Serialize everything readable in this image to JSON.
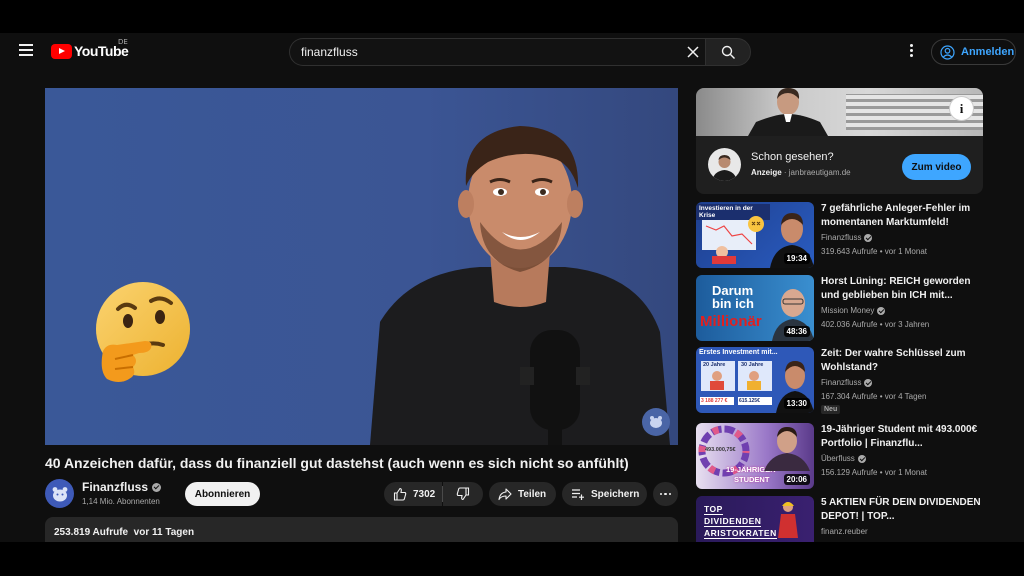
{
  "header": {
    "logo_text": "YouTube",
    "region": "DE",
    "search_value": "finanzfluss",
    "signin_label": "Anmelden"
  },
  "video": {
    "title": "40 Anzeichen dafür, dass du finanziell gut dastehst (auch wenn es sich nicht so anfühlt)",
    "channel": "Finanzfluss",
    "subscribers": "1,14 Mio. Abonnenten",
    "subscribe_label": "Abonnieren",
    "likes": "7302",
    "share_label": "Teilen",
    "save_label": "Speichern",
    "views": "253.819 Aufrufe",
    "age": "vor 11 Tagen"
  },
  "ad": {
    "title": "Schon gesehen?",
    "label": "Anzeige",
    "domain": "janbraeutigam.de",
    "cta": "Zum video"
  },
  "recommendations": [
    {
      "title": "7 gefährliche Anleger-Fehler im momentanen Marktumfeld!",
      "channel": "Finanzfluss",
      "views": "319.643 Aufrufe",
      "age": "vor 1 Monat",
      "duration": "19:34",
      "thumb_text": "Investieren in der Krise"
    },
    {
      "title": "Horst Lüning: REICH geworden und geblieben bin ICH mit...",
      "channel": "Mission Money",
      "views": "402.036 Aufrufe",
      "age": "vor 3 Jahren",
      "duration": "48:36",
      "thumb_line1": "Darum",
      "thumb_line2": "bin ich",
      "thumb_line3": "Millionär"
    },
    {
      "title": "Zeit: Der wahre Schlüssel zum Wohlstand?",
      "channel": "Finanzfluss",
      "views": "167.304 Aufrufe",
      "age": "vor 4 Tagen",
      "duration": "13:30",
      "badge": "Neu",
      "thumb_text": "Erstes Investment mit...",
      "thumb_col1": "20 Jahre",
      "thumb_col2": "30 Jahre",
      "thumb_val1": "3 188 277 €",
      "thumb_val2": "615.125€"
    },
    {
      "title": "19-Jähriger Student mit 493.000€ Portfolio | Finanzflu...",
      "channel": "Überfluss",
      "views": "156.129 Aufrufe",
      "age": "vor 1 Monat",
      "duration": "20:06",
      "thumb_val": "493.000,75€",
      "thumb_line1": "19-JÄHRIGER",
      "thumb_line2": "STUDENT"
    },
    {
      "title": "5 AKTIEN FÜR DEIN DIVIDENDEN DEPOT! | TOP...",
      "channel": "finanz.reuber",
      "thumb_line1": "TOP",
      "thumb_line2": "DIVIDENDEN",
      "thumb_line3": "ARISTOKRATEN"
    }
  ]
}
